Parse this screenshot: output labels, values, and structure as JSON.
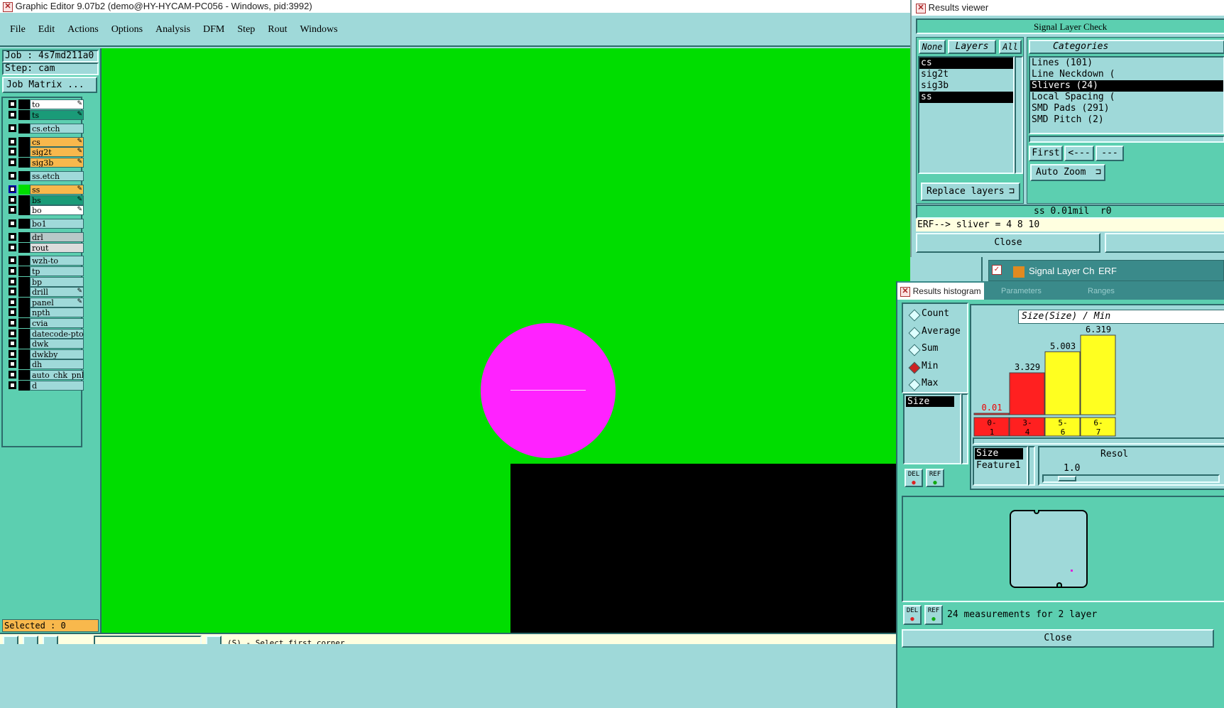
{
  "main_window": {
    "title": "Graphic Editor 9.07b2 (demo@HY-HYCAM-PC056 - Windows, pid:3992)",
    "menu": [
      "File",
      "Edit",
      "Actions",
      "Options",
      "Analysis",
      "DFM",
      "Step",
      "Rout",
      "Windows"
    ]
  },
  "left_panel": {
    "job": "Job : 4s7md211a0",
    "step": "Step: cam",
    "job_matrix_label": "Job Matrix ...",
    "selected": "Selected : 0"
  },
  "layers": [
    {
      "name": "to",
      "color": "#ffffff",
      "edit": true
    },
    {
      "name": "ts",
      "color": "#1a9b78",
      "edit": true
    },
    {
      "name": "cs.etch",
      "color": "#9fd9d9",
      "edit": false
    },
    {
      "name": "cs",
      "color": "#f8b84c",
      "edit": true
    },
    {
      "name": "sig2t",
      "color": "#f8b84c",
      "edit": true
    },
    {
      "name": "sig3b",
      "color": "#f8b84c",
      "edit": true
    },
    {
      "name": "ss.etch",
      "color": "#9fd9d9",
      "edit": false
    },
    {
      "name": "ss",
      "color": "#f8b84c",
      "edit": true
    },
    {
      "name": "bs",
      "color": "#1a9b78",
      "edit": true
    },
    {
      "name": "bo",
      "color": "#ffffff",
      "edit": true
    },
    {
      "name": "bo1",
      "color": "#9fd9d9",
      "edit": false
    },
    {
      "name": "drl",
      "color": "#b8c8c8",
      "edit": false
    },
    {
      "name": "rout",
      "color": "#dcdcdc",
      "edit": false
    },
    {
      "name": "wzh-to",
      "color": "#9fd9d9",
      "edit": false
    },
    {
      "name": "tp",
      "color": "#9fd9d9",
      "edit": false
    },
    {
      "name": "bp",
      "color": "#9fd9d9",
      "edit": false
    },
    {
      "name": "drill",
      "color": "#9fd9d9",
      "edit": true
    },
    {
      "name": "panel",
      "color": "#9fd9d9",
      "edit": true
    },
    {
      "name": "npth",
      "color": "#9fd9d9",
      "edit": false
    },
    {
      "name": "cvia",
      "color": "#9fd9d9",
      "edit": false
    },
    {
      "name": "datecode-pto",
      "color": "#9fd9d9",
      "edit": false
    },
    {
      "name": "dwk",
      "color": "#9fd9d9",
      "edit": false
    },
    {
      "name": "dwkby",
      "color": "#9fd9d9",
      "edit": false
    },
    {
      "name": "dh",
      "color": "#9fd9d9",
      "edit": false
    },
    {
      "name": "auto_chk_pnl",
      "color": "#9fd9d9",
      "edit": false
    },
    {
      "name": "d",
      "color": "#9fd9d9",
      "edit": false
    }
  ],
  "status_bar": {
    "prompt": "(S) - Select first corner"
  },
  "results_viewer": {
    "title": "Results viewer",
    "header": "Signal Layer Check",
    "none_label": "None",
    "layers_label": "Layers",
    "all_label": "All",
    "categories_label": "Categories",
    "layer_list": [
      "cs",
      "sig2t",
      "sig3b",
      "ss"
    ],
    "selected_layers": [
      "cs",
      "ss"
    ],
    "categories": [
      "Lines (101)",
      "Line Neckdown (",
      "Slivers (24)",
      "Local Spacing (",
      "SMD Pads (291)",
      "SMD Pitch (2)"
    ],
    "selected_category": "Slivers (24)",
    "first_label": "First",
    "prev_label": "<---",
    "next_label": "---",
    "auto_zoom_label": "Auto Zoom",
    "replace_layers_label": "Replace layers",
    "info_line": "ss 0.01mil  r0",
    "erf_line": "ERF--> sliver = 4 8 10",
    "close_label": "Close",
    "taskbar_item": "Signal Layer Ch",
    "taskbar_item2": "ERF"
  },
  "results_histogram": {
    "title": "Results histogram",
    "tab2": "Parameters",
    "tab3": "Ranges",
    "stats": [
      "Count",
      "Average",
      "Sum",
      "Min",
      "Max"
    ],
    "selected_stat": "Min",
    "measure_list": [
      "Size"
    ],
    "header": "Size(Size) / Min",
    "sort_list": [
      "Size",
      "Feature1"
    ],
    "resolution_label": "Resol",
    "resolution_value": "1.0",
    "del_label": "DEL",
    "ref_label": "REF",
    "measurement_text": "24 measurements for 2 layer",
    "close_label": "Close"
  },
  "chart_data": {
    "type": "bar",
    "categories": [
      "0-1",
      "3-4",
      "5-6",
      "6-7"
    ],
    "values": [
      0.01,
      3.329,
      5.003,
      6.319
    ],
    "value_labels": [
      "0.01",
      "3.329",
      "5.003",
      "6.319"
    ],
    "bar_colors": [
      "#ff2020",
      "#ff2020",
      "#ffff20",
      "#ffff20"
    ],
    "title": "Size(Size) / Min"
  },
  "colors": {
    "canvas_bg": "#00dd00",
    "pad_magenta": "#ff22ff",
    "ui_teal": "#9fd9d9",
    "panel_green": "#5ccfb0"
  }
}
